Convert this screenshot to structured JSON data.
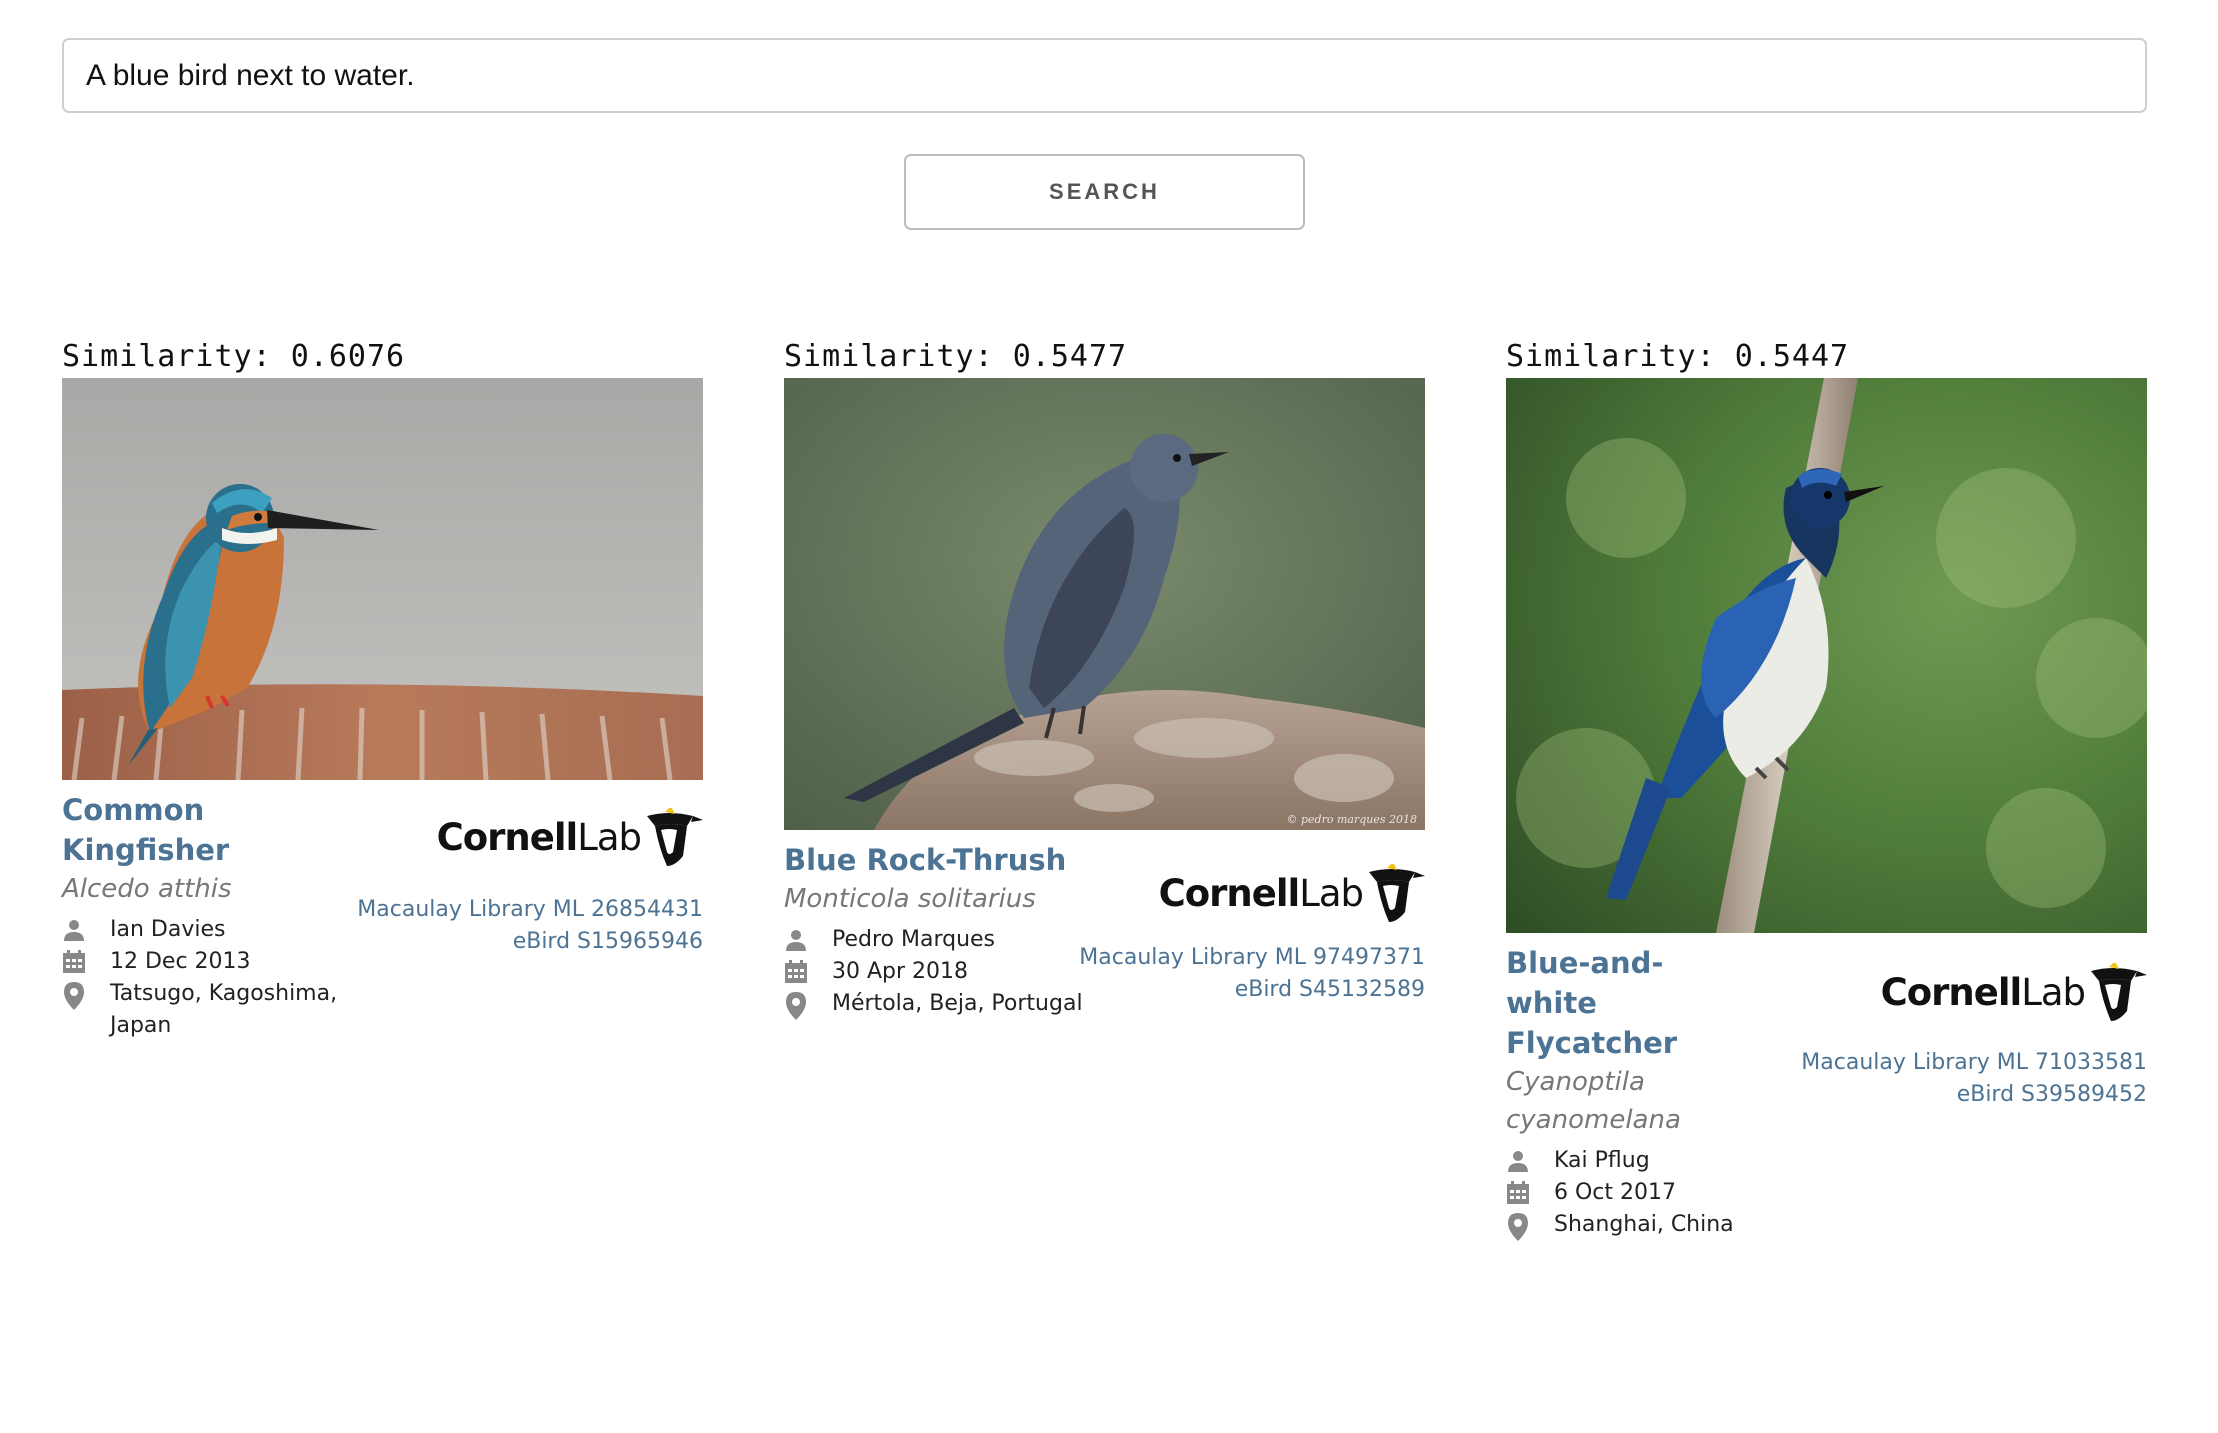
{
  "search": {
    "query": "A blue bird next to water.",
    "button_label": "SEARCH"
  },
  "results": [
    {
      "similarity": "Similarity: 0.6076",
      "common_name": "Common Kingfisher",
      "scientific_name": "Alcedo atthis",
      "photographer": "Ian Davies",
      "date": "12 Dec 2013",
      "location": "Tatsugo, Kagoshima, Japan",
      "brand": {
        "bold": "Cornell",
        "light": "Lab"
      },
      "macaulay_link": "Macaulay Library ML 26854431",
      "ebird_link": "eBird S15965946"
    },
    {
      "similarity": "Similarity: 0.5477",
      "common_name": "Blue Rock-Thrush",
      "scientific_name": "Monticola solitarius",
      "photographer": "Pedro Marques",
      "date": "30 Apr 2018",
      "location": "Mértola, Beja, Portugal",
      "photo_credit": "© pedro marques 2018",
      "brand": {
        "bold": "Cornell",
        "light": "Lab"
      },
      "macaulay_link": "Macaulay Library ML 97497371",
      "ebird_link": "eBird S45132589"
    },
    {
      "similarity": "Similarity: 0.5447",
      "common_name": "Blue-and-white Flycatcher",
      "scientific_name": "Cyanoptila cyanomelana",
      "photographer": "Kai Pflug",
      "date": "6 Oct 2017",
      "location": "Shanghai, China",
      "brand": {
        "bold": "Cornell",
        "light": "Lab"
      },
      "macaulay_link": "Macaulay Library ML 71033581",
      "ebird_link": "eBird S39589452"
    }
  ],
  "icons": {
    "person": "person-icon",
    "calendar": "calendar-icon",
    "location": "location-pin-icon",
    "logo": "cornell-lab-bird-logo-icon"
  },
  "colors": {
    "link": "#4d7394",
    "scientific": "#777777",
    "text": "#222222"
  }
}
